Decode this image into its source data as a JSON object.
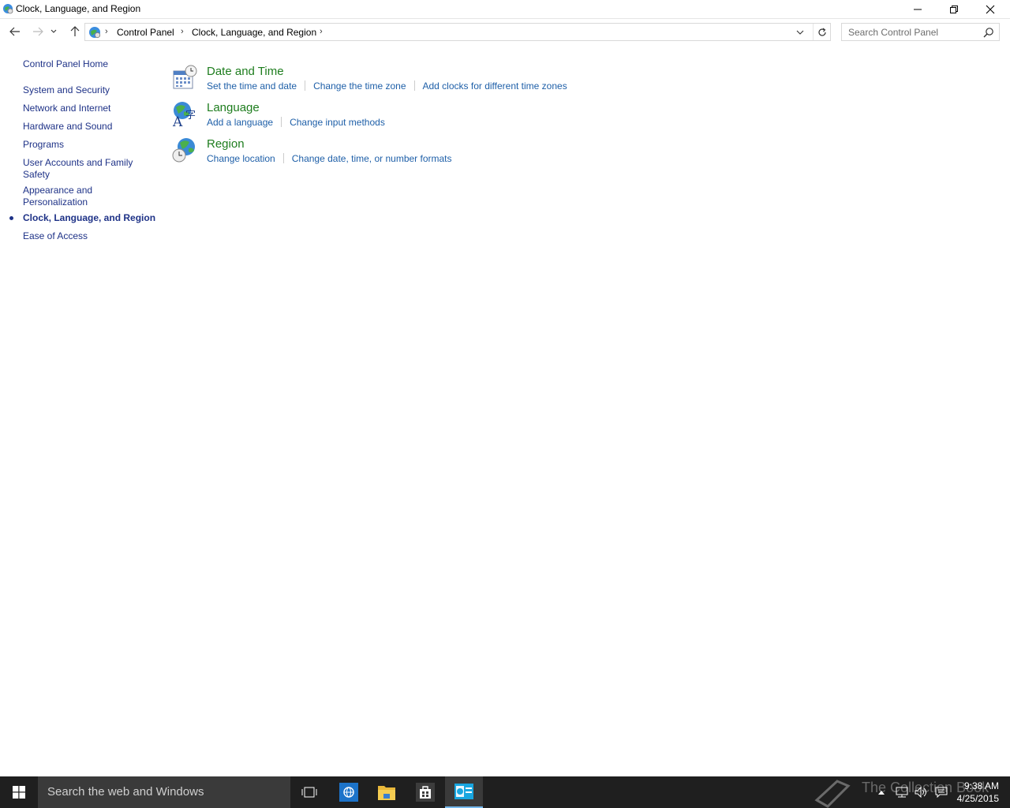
{
  "window": {
    "title": "Clock, Language, and Region"
  },
  "address": {
    "crumbs": [
      "Control Panel",
      "Clock, Language, and Region"
    ]
  },
  "search": {
    "placeholder": "Search Control Panel"
  },
  "leftnav": {
    "home": "Control Panel Home",
    "items": [
      "System and Security",
      "Network and Internet",
      "Hardware and Sound",
      "Programs",
      "User Accounts and Family Safety",
      "Appearance and Personalization",
      "Clock, Language, and Region",
      "Ease of Access"
    ],
    "current_index": 6
  },
  "categories": [
    {
      "title": "Date and Time",
      "icon": "calendar-clock-icon",
      "links": [
        "Set the time and date",
        "Change the time zone",
        "Add clocks for different time zones"
      ]
    },
    {
      "title": "Language",
      "icon": "language-globe-icon",
      "links": [
        "Add a language",
        "Change input methods"
      ]
    },
    {
      "title": "Region",
      "icon": "region-globe-icon",
      "links": [
        "Change location",
        "Change date, time, or number formats"
      ]
    }
  ],
  "taskbar": {
    "search_text": "Search the web and Windows",
    "time": "9:38 AM",
    "date": "4/25/2015",
    "watermark": "The Collection Book"
  },
  "colors": {
    "link": "#1e5fa8",
    "nav_link": "#1e3287",
    "category_title": "#1e7d1e",
    "taskbar": "#1f1f1f"
  }
}
